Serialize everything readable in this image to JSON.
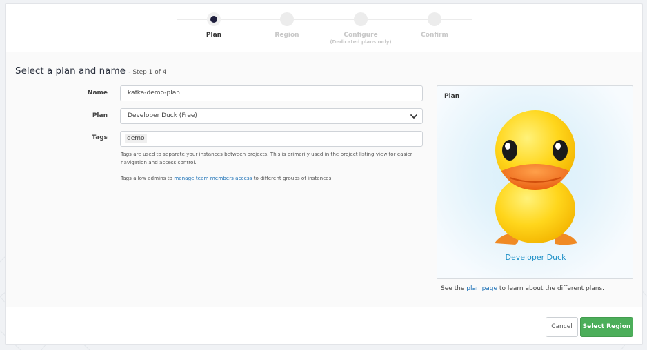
{
  "steps": [
    {
      "label": "Plan",
      "sublabel": ""
    },
    {
      "label": "Region",
      "sublabel": ""
    },
    {
      "label": "Configure",
      "sublabel": "(Dedicated plans only)"
    },
    {
      "label": "Confirm",
      "sublabel": ""
    }
  ],
  "current_step": 1,
  "page": {
    "title": "Select a plan and name",
    "step_text": "- Step 1 of 4"
  },
  "form": {
    "name_label": "Name",
    "name_value": "kafka-demo-plan",
    "plan_label": "Plan",
    "plan_value": "Developer Duck (Free)",
    "tags_label": "Tags",
    "tags": [
      "demo"
    ],
    "tags_help": "Tags are used to separate your instances between projects. This is primarily used in the project listing view for easier navigation and access control.",
    "tags_help2_prefix": "Tags allow admins to ",
    "tags_help2_link": "manage team members access",
    "tags_help2_suffix": " to different groups of instances."
  },
  "plan_panel": {
    "label": "Plan",
    "plan_name": "Developer Duck",
    "note_prefix": "See the ",
    "note_link": "plan page",
    "note_suffix": " to learn about the different plans."
  },
  "footer": {
    "cancel_label": "Cancel",
    "submit_label": "Select Region"
  },
  "colors": {
    "primary_button": "#4cae5a",
    "link": "#1f73b7",
    "plan_name": "#1c8fc6",
    "active_step_dot": "#1e1e3c",
    "duck_body": "#ffd21a",
    "duck_beak": "#f07a1e"
  }
}
